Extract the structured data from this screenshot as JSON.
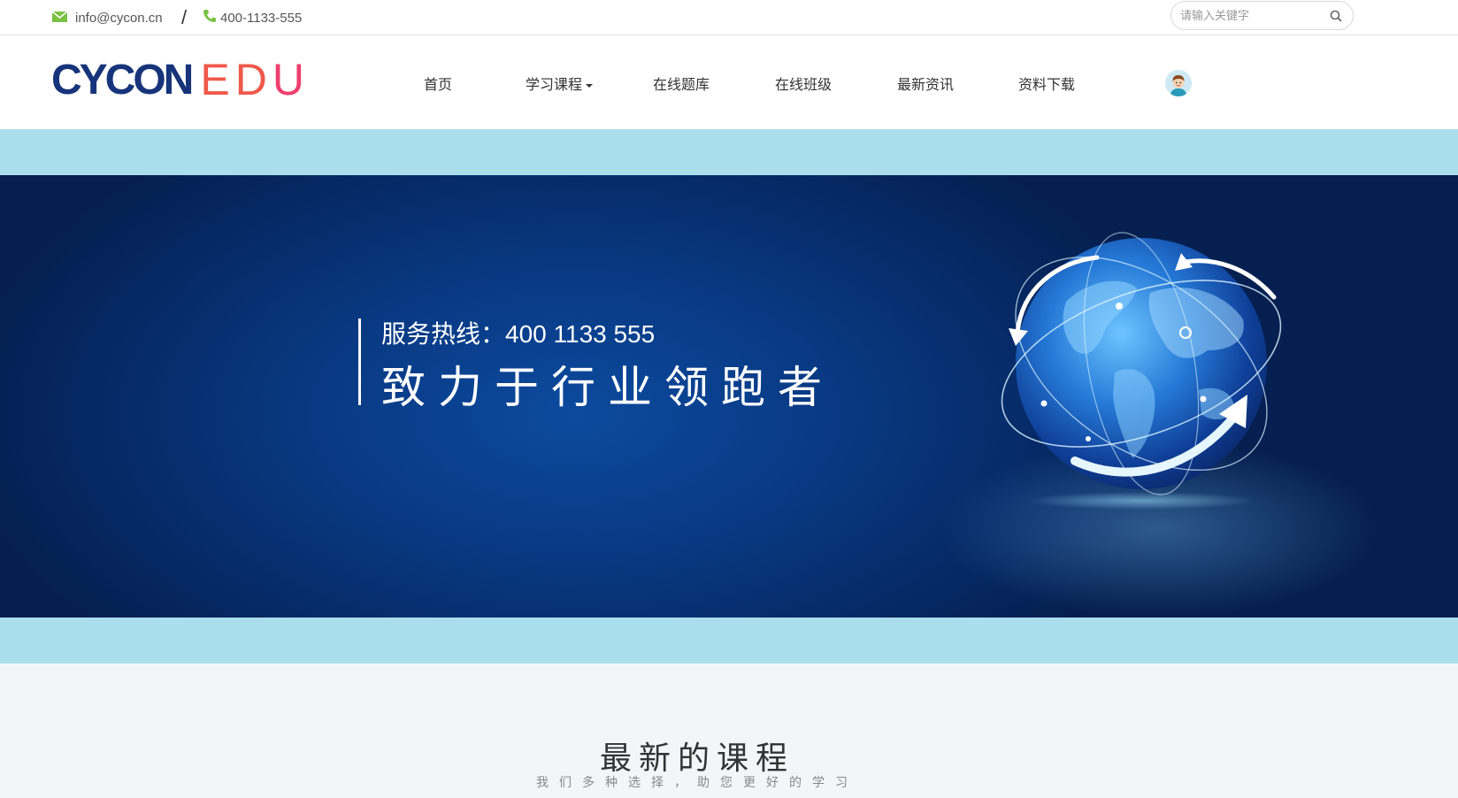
{
  "topbar": {
    "email": "info@cycon.cn",
    "separator": "/",
    "phone": "400-1133-555",
    "search_placeholder": "请输入关键字"
  },
  "logo": {
    "part1": "CYCON",
    "e": "E",
    "d": "D",
    "u": "U"
  },
  "nav": {
    "home": "首页",
    "courses": "学习课程",
    "question_bank": "在线题库",
    "classes": "在线班级",
    "news": "最新资讯",
    "downloads": "资料下载"
  },
  "banner": {
    "hotline": "服务热线：400 1133 555",
    "slogan": "致力于行业领跑者",
    "slide_count": 2,
    "active_slide": 2
  },
  "section": {
    "title": "最新的课程",
    "subtitle": "我们多种选择，助您更好的学习"
  },
  "colors": {
    "accent": "#f0584b",
    "brand_blue": "#17347a",
    "banner_bg": "#abdeec",
    "icon_green": "#7ac143"
  },
  "icons": [
    "mail-icon",
    "phone-icon",
    "search-icon",
    "chevron-down-icon",
    "user-avatar",
    "globe-illustration"
  ]
}
